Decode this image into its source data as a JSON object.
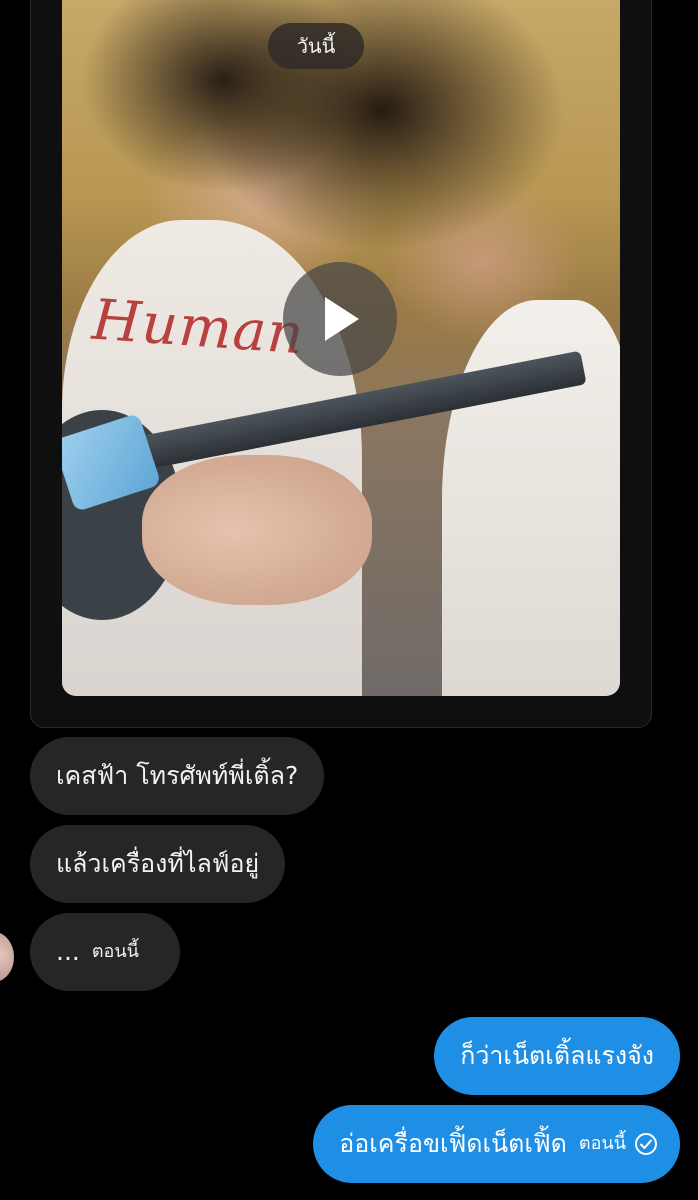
{
  "date_header": "วันนี้",
  "media": {
    "shirt_text": "Human"
  },
  "messages": [
    {
      "text": "เคสฟ้า โทรศัพท์พี่เติ้ล?"
    },
    {
      "text": "แล้วเครื่องที่ไลฟ์อยู่"
    },
    {
      "text": "...",
      "time": "ตอนนี้"
    },
    {
      "text": "ก็ว่าเน็ตเติ้ลแรงจัง"
    },
    {
      "text": "อ่อเครื่อขเฟิ้ดเน็ตเฟิ้ด",
      "time": "ตอนนี้"
    }
  ],
  "icons": {
    "play": "play-icon",
    "read": "check-circle-icon"
  },
  "colors": {
    "outgoing": "#1f8fe6",
    "incoming": "#262626",
    "background": "#000000"
  }
}
